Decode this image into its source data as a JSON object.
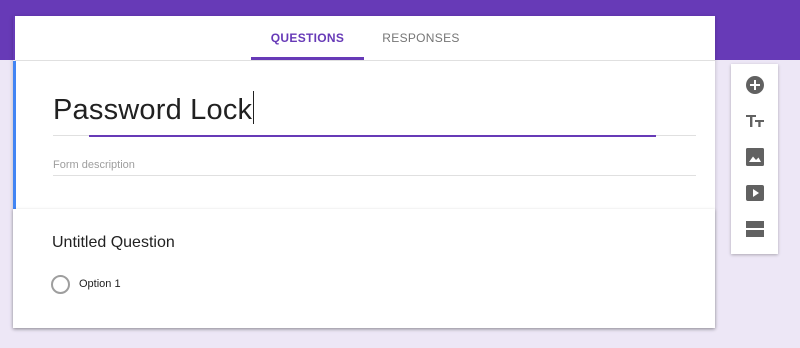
{
  "tabs": {
    "questions_label": "QUESTIONS",
    "responses_label": "RESPONSES"
  },
  "form": {
    "title": "Password Lock",
    "description_placeholder": "Form description"
  },
  "question": {
    "title": "Untitled Question",
    "options": [
      "Option 1"
    ]
  },
  "toolbar": {
    "tools": [
      "add-question-icon",
      "add-title-icon",
      "add-image-icon",
      "add-video-icon",
      "add-section-icon"
    ]
  },
  "colors": {
    "header_band": "#673ab7",
    "accent": "#673ab7",
    "active_card_border": "#4285f4",
    "background": "#ede7f6",
    "icon": "#616161"
  }
}
